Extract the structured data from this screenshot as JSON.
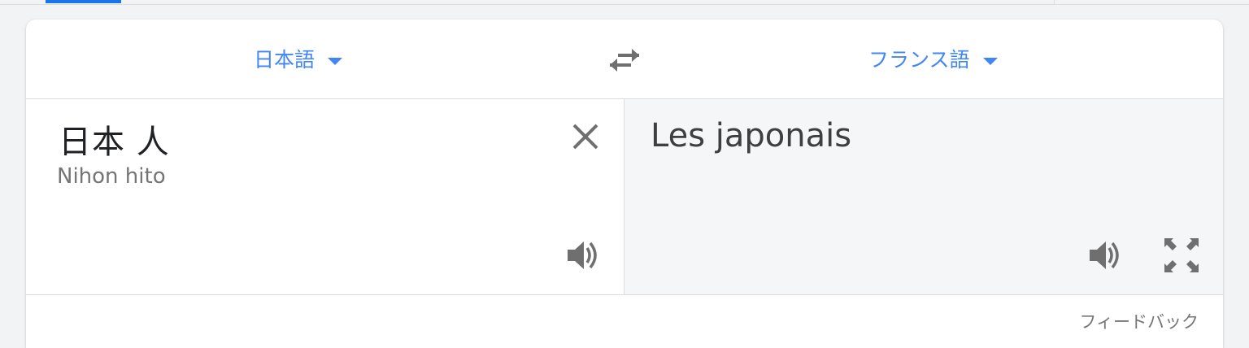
{
  "header": {
    "source_language": "日本語",
    "target_language": "フランス語"
  },
  "source": {
    "text": "日本 人",
    "romanization": "Nihon hito"
  },
  "target": {
    "text": "Les japonais"
  },
  "footer": {
    "feedback_label": "フィードバック"
  },
  "icons": {
    "swap": "swap-languages-icon",
    "clear": "close-icon",
    "listen": "speaker-icon",
    "fullscreen": "fullscreen-icon",
    "dropdown": "caret-down-icon"
  },
  "colors": {
    "accent": "#4285f4",
    "icon": "#6f6f6f",
    "target_bg": "#f5f6f8"
  }
}
